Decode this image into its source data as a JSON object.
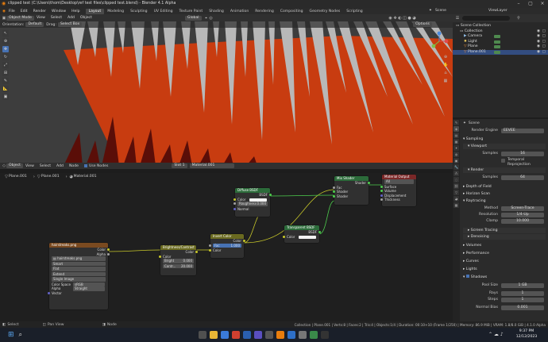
{
  "window": {
    "title": "clipped test (C:\\Users\\thom\\Desktop\\ref test files\\clipped test.blend) - Blender 4.1 Alpha"
  },
  "menu": {
    "items": [
      "File",
      "Edit",
      "Render",
      "Window",
      "Help"
    ]
  },
  "workspaces": [
    "Layout",
    "Modeling",
    "Sculpting",
    "UV Editing",
    "Texture Paint",
    "Shading",
    "Animation",
    "Rendering",
    "Compositing",
    "Geometry Nodes",
    "Scripting"
  ],
  "topright": {
    "scene": "Scene",
    "viewlayer": "ViewLayer"
  },
  "viewport": {
    "mode": "Object Mode",
    "menus": [
      "View",
      "Select",
      "Add",
      "Object"
    ],
    "orientation_label": "Orientation:",
    "orientation": "Default",
    "drag_label": "Drag:",
    "drag": "Select Box",
    "pivot": "Global",
    "options": "Options"
  },
  "outliner": {
    "search_placeholder": "",
    "items": [
      {
        "label": "Scene Collection",
        "indent": 0,
        "selected": false
      },
      {
        "label": "Collection",
        "indent": 1,
        "selected": false
      },
      {
        "label": "Camera",
        "indent": 2,
        "selected": false
      },
      {
        "label": "Light",
        "indent": 2,
        "selected": false
      },
      {
        "label": "Plane",
        "indent": 2,
        "selected": false
      },
      {
        "label": "Plane.001",
        "indent": 2,
        "selected": true
      }
    ]
  },
  "properties": {
    "scene_name": "Scene",
    "render_engine_label": "Render Engine",
    "render_engine": "EEVEE",
    "sampling": "Sampling",
    "viewport": "Viewport",
    "samples_label": "Samples",
    "viewport_samples": "16",
    "temporal_reprojection": "Temporal Reprojection",
    "render": "Render",
    "render_samples": "64",
    "depth_of_field": "Depth of Field",
    "horizon_scan": "Horizon Scan",
    "raytracing": "Raytracing",
    "method_label": "Method",
    "method": "Screen-Trace",
    "resolution_label": "Resolution",
    "resolution": "1/4-Up",
    "clamp_label": "Clamp",
    "clamp": "10.000",
    "screen_tracing": "Screen Tracing",
    "denoising": "Denoising",
    "volumes": "Volumes",
    "performance": "Performance",
    "curves": "Curves",
    "lights": "Lights",
    "shadows": "Shadows",
    "pool_size_label": "Pool Size",
    "pool_size": "1 GB",
    "rays_label": "Rays",
    "rays": "1",
    "steps_label": "Steps",
    "steps": "1",
    "normal_bias_label": "Normal Bias",
    "normal_bias": "0.001"
  },
  "node_editor": {
    "menus": [
      "Object",
      "View",
      "Select",
      "Add",
      "Node"
    ],
    "use_nodes": "Use Nodes",
    "slot": "Slot 1",
    "material": "Material.001",
    "breadcrumb": [
      "Plane.001",
      "Plane.001",
      "Material.001"
    ]
  },
  "nodes": {
    "image": {
      "title": "hairstreaks.png",
      "out_color": "Color",
      "out_alpha": "Alpha",
      "file": "hairstreaks.png",
      "interp": "Smart",
      "proj": "Flat",
      "ext": "Extend",
      "source": "Single Image",
      "cs_label": "Color Space",
      "cs": "sRGB",
      "alpha_label": "Alpha",
      "alpha": "Straight",
      "vector": "Vector"
    },
    "bc": {
      "title": "Brightness/Contrast",
      "out": "Color",
      "color": "Color",
      "bright_label": "Bright",
      "bright": "0.000",
      "contrast_label": "Contr...",
      "contrast": "20.000"
    },
    "invert": {
      "title": "Invert Color",
      "out": "Color",
      "fac_label": "Fac",
      "fac": "1.000",
      "color": "Color"
    },
    "diffuse": {
      "title": "Diffuse BSDF",
      "out": "BSDF",
      "color": "Color",
      "rough_label": "Roughness",
      "rough": "0.000",
      "normal": "Normal"
    },
    "transparent": {
      "title": "Transparent BSDF",
      "out": "BSDF",
      "color": "Color"
    },
    "mix": {
      "title": "Mix Shader",
      "out": "Shader",
      "fac": "Fac",
      "s1": "Shader",
      "s2": "Shader"
    },
    "output": {
      "title": "Material Output",
      "target": "All",
      "surface": "Surface",
      "volume": "Volume",
      "displacement": "Displacement",
      "thickness": "Thickness"
    }
  },
  "statusbar": {
    "left1": "Select",
    "left2": "Pan View",
    "left3": "Node",
    "right": "Collection | Plane.001 | Verts:8 | Faces:2 | Tris:4 | Objects:1/4 | Duration: 00:10+10 (Frame 1/250) | Memory: 86.9 MiB | VRAM: 1.8/8.0 GiB | 4.1.0 Alpha"
  },
  "taskbar": {
    "time": "9:37 PM",
    "date": "12/12/2023"
  },
  "colors": {
    "accent": "#4772b3",
    "plane": "#c83c10",
    "viewport_bg": "#3d3d3d",
    "strand": "#b8b8b8"
  }
}
